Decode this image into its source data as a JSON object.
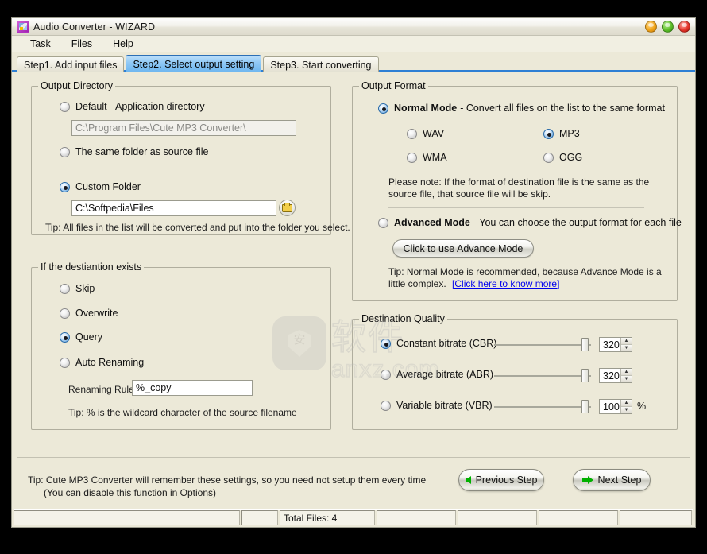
{
  "window": {
    "title": "Audio Converter - WIZARD",
    "buttons": [
      {
        "name": "minimize",
        "color": "#f0a419"
      },
      {
        "name": "maximize",
        "color": "#5fbf2a"
      },
      {
        "name": "close",
        "color": "#e5362c"
      }
    ]
  },
  "menubar": {
    "items": [
      {
        "accel": "T",
        "rest": "ask"
      },
      {
        "accel": "F",
        "rest": "iles"
      },
      {
        "accel": "H",
        "rest": "elp"
      }
    ]
  },
  "tabs": [
    {
      "label": "Step1. Add input files",
      "active": false
    },
    {
      "label": "Step2. Select output setting",
      "active": true
    },
    {
      "label": "Step3. Start converting",
      "active": false
    }
  ],
  "output_directory": {
    "legend": "Output Directory",
    "options": [
      {
        "label": "Default - Application directory",
        "selected": false
      },
      {
        "label": "The same folder as source file",
        "selected": false
      },
      {
        "label": "Custom Folder",
        "selected": true
      }
    ],
    "default_path_value": "C:\\Program Files\\Cute MP3 Converter\\",
    "custom_path_value": "C:\\Softpedia\\Files",
    "browse_icon": "folder-icon",
    "tip": "Tip: All files in the list will be converted and put into the folder you select."
  },
  "destination_exists": {
    "legend": "If the destiantion exists",
    "options": [
      {
        "label": "Skip",
        "selected": false
      },
      {
        "label": "Overwrite",
        "selected": false
      },
      {
        "label": "Query",
        "selected": true
      },
      {
        "label": "Auto Renaming",
        "selected": false
      }
    ],
    "renaming_rule_label": "Renaming Rule:",
    "renaming_rule_value": "%_copy",
    "tip": "Tip: % is the wildcard character of the source filename"
  },
  "output_format": {
    "legend": "Output Format",
    "normal_mode": {
      "title": "Normal Mode",
      "description": "- Convert all files on the list to the same format",
      "selected": true
    },
    "formats": [
      {
        "label": "WAV",
        "selected": false
      },
      {
        "label": "WMA",
        "selected": false
      },
      {
        "label": "MP3",
        "selected": true
      },
      {
        "label": "OGG",
        "selected": false
      }
    ],
    "note_line1": "Please note: If  the format of destination file is the same as the",
    "note_line2": "source file,  that source file will be skip.",
    "advanced_mode": {
      "title": "Advanced Mode",
      "description": "- You can choose the output format for each file",
      "selected": false
    },
    "advanced_button": "Click to use Advance Mode",
    "advanced_tip_line1": "Tip: Normal Mode is recommended, because Advance Mode is a",
    "advanced_tip_line2": "little complex.",
    "advanced_tip_link": "[Click here to know more]"
  },
  "destination_quality": {
    "legend": "Destination Quality",
    "rows": [
      {
        "label": "Constant bitrate (CBR)",
        "selected": true,
        "value": "320",
        "unit": "",
        "slider_pct": 97
      },
      {
        "label": "Average bitrate (ABR)",
        "selected": false,
        "value": "320",
        "unit": "",
        "slider_pct": 97
      },
      {
        "label": "Variable bitrate (VBR)",
        "selected": false,
        "value": "100",
        "unit": "%",
        "slider_pct": 97
      }
    ]
  },
  "bottom": {
    "tip": "Tip: Cute MP3 Converter will remember these settings, so you need not setup them every time\n      (You can disable this function in Options)",
    "previous_label": "Previous Step",
    "next_label": "Next Step"
  },
  "statusbar": {
    "panels": [
      "",
      "",
      "Total Files: 4",
      "",
      "",
      "",
      ""
    ]
  },
  "watermark": {
    "shield_char": "安",
    "cn_text": "软件",
    "site": "anxz.com"
  }
}
